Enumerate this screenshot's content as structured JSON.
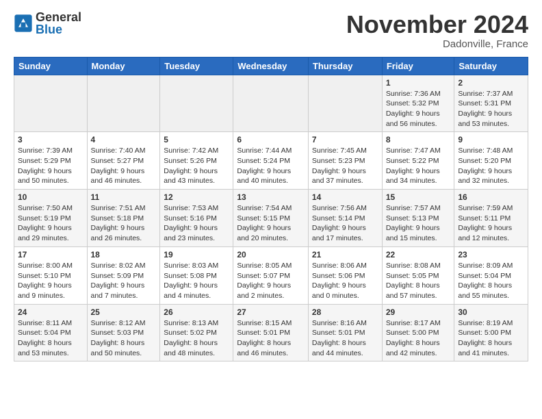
{
  "header": {
    "logo": {
      "general": "General",
      "blue": "Blue"
    },
    "title": "November 2024",
    "location": "Dadonville, France"
  },
  "calendar": {
    "days_of_week": [
      "Sunday",
      "Monday",
      "Tuesday",
      "Wednesday",
      "Thursday",
      "Friday",
      "Saturday"
    ],
    "weeks": [
      [
        {
          "day": "",
          "info": ""
        },
        {
          "day": "",
          "info": ""
        },
        {
          "day": "",
          "info": ""
        },
        {
          "day": "",
          "info": ""
        },
        {
          "day": "",
          "info": ""
        },
        {
          "day": "1",
          "info": "Sunrise: 7:36 AM\nSunset: 5:32 PM\nDaylight: 9 hours and 56 minutes."
        },
        {
          "day": "2",
          "info": "Sunrise: 7:37 AM\nSunset: 5:31 PM\nDaylight: 9 hours and 53 minutes."
        }
      ],
      [
        {
          "day": "3",
          "info": "Sunrise: 7:39 AM\nSunset: 5:29 PM\nDaylight: 9 hours and 50 minutes."
        },
        {
          "day": "4",
          "info": "Sunrise: 7:40 AM\nSunset: 5:27 PM\nDaylight: 9 hours and 46 minutes."
        },
        {
          "day": "5",
          "info": "Sunrise: 7:42 AM\nSunset: 5:26 PM\nDaylight: 9 hours and 43 minutes."
        },
        {
          "day": "6",
          "info": "Sunrise: 7:44 AM\nSunset: 5:24 PM\nDaylight: 9 hours and 40 minutes."
        },
        {
          "day": "7",
          "info": "Sunrise: 7:45 AM\nSunset: 5:23 PM\nDaylight: 9 hours and 37 minutes."
        },
        {
          "day": "8",
          "info": "Sunrise: 7:47 AM\nSunset: 5:22 PM\nDaylight: 9 hours and 34 minutes."
        },
        {
          "day": "9",
          "info": "Sunrise: 7:48 AM\nSunset: 5:20 PM\nDaylight: 9 hours and 32 minutes."
        }
      ],
      [
        {
          "day": "10",
          "info": "Sunrise: 7:50 AM\nSunset: 5:19 PM\nDaylight: 9 hours and 29 minutes."
        },
        {
          "day": "11",
          "info": "Sunrise: 7:51 AM\nSunset: 5:18 PM\nDaylight: 9 hours and 26 minutes."
        },
        {
          "day": "12",
          "info": "Sunrise: 7:53 AM\nSunset: 5:16 PM\nDaylight: 9 hours and 23 minutes."
        },
        {
          "day": "13",
          "info": "Sunrise: 7:54 AM\nSunset: 5:15 PM\nDaylight: 9 hours and 20 minutes."
        },
        {
          "day": "14",
          "info": "Sunrise: 7:56 AM\nSunset: 5:14 PM\nDaylight: 9 hours and 17 minutes."
        },
        {
          "day": "15",
          "info": "Sunrise: 7:57 AM\nSunset: 5:13 PM\nDaylight: 9 hours and 15 minutes."
        },
        {
          "day": "16",
          "info": "Sunrise: 7:59 AM\nSunset: 5:11 PM\nDaylight: 9 hours and 12 minutes."
        }
      ],
      [
        {
          "day": "17",
          "info": "Sunrise: 8:00 AM\nSunset: 5:10 PM\nDaylight: 9 hours and 9 minutes."
        },
        {
          "day": "18",
          "info": "Sunrise: 8:02 AM\nSunset: 5:09 PM\nDaylight: 9 hours and 7 minutes."
        },
        {
          "day": "19",
          "info": "Sunrise: 8:03 AM\nSunset: 5:08 PM\nDaylight: 9 hours and 4 minutes."
        },
        {
          "day": "20",
          "info": "Sunrise: 8:05 AM\nSunset: 5:07 PM\nDaylight: 9 hours and 2 minutes."
        },
        {
          "day": "21",
          "info": "Sunrise: 8:06 AM\nSunset: 5:06 PM\nDaylight: 9 hours and 0 minutes."
        },
        {
          "day": "22",
          "info": "Sunrise: 8:08 AM\nSunset: 5:05 PM\nDaylight: 8 hours and 57 minutes."
        },
        {
          "day": "23",
          "info": "Sunrise: 8:09 AM\nSunset: 5:04 PM\nDaylight: 8 hours and 55 minutes."
        }
      ],
      [
        {
          "day": "24",
          "info": "Sunrise: 8:11 AM\nSunset: 5:04 PM\nDaylight: 8 hours and 53 minutes."
        },
        {
          "day": "25",
          "info": "Sunrise: 8:12 AM\nSunset: 5:03 PM\nDaylight: 8 hours and 50 minutes."
        },
        {
          "day": "26",
          "info": "Sunrise: 8:13 AM\nSunset: 5:02 PM\nDaylight: 8 hours and 48 minutes."
        },
        {
          "day": "27",
          "info": "Sunrise: 8:15 AM\nSunset: 5:01 PM\nDaylight: 8 hours and 46 minutes."
        },
        {
          "day": "28",
          "info": "Sunrise: 8:16 AM\nSunset: 5:01 PM\nDaylight: 8 hours and 44 minutes."
        },
        {
          "day": "29",
          "info": "Sunrise: 8:17 AM\nSunset: 5:00 PM\nDaylight: 8 hours and 42 minutes."
        },
        {
          "day": "30",
          "info": "Sunrise: 8:19 AM\nSunset: 5:00 PM\nDaylight: 8 hours and 41 minutes."
        }
      ]
    ]
  }
}
